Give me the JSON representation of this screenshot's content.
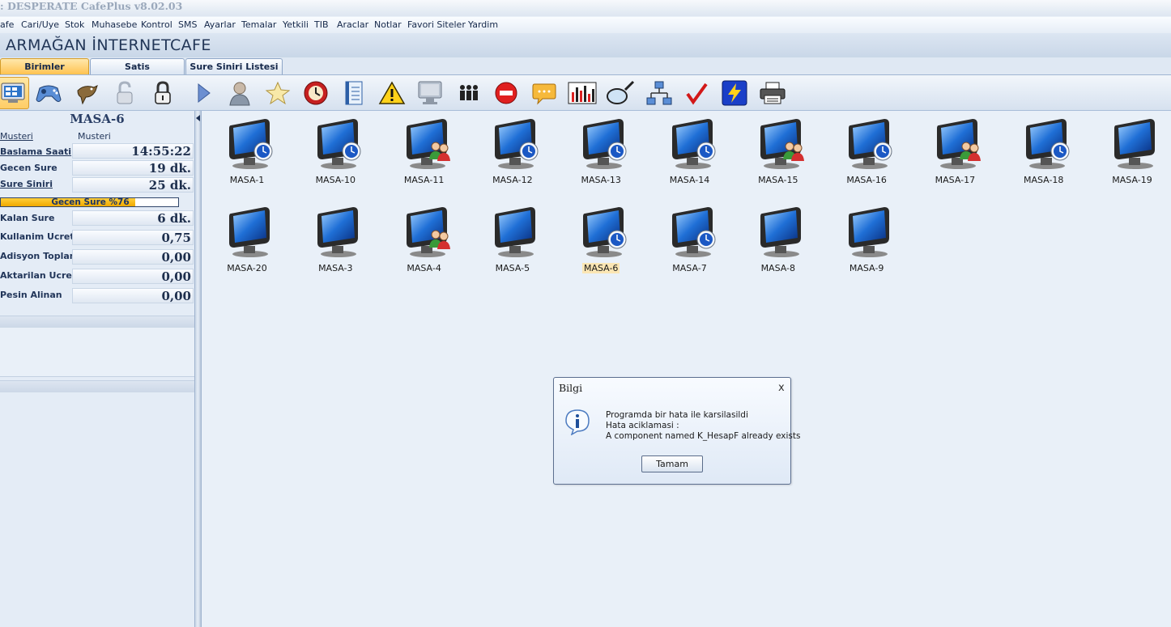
{
  "window": {
    "title": ": DESPERATE CafePlus v8.02.03"
  },
  "menu": [
    "afe",
    "Cari/Uye",
    "Stok",
    "Muhasebe",
    "Kontrol",
    "SMS",
    "Ayarlar",
    "Temalar",
    "Yetkili",
    "TIB",
    "Araclar",
    "Notlar",
    "Favori Siteler",
    "Yardim"
  ],
  "cafe_name": "ARMAĞAN İNTERNETCAFE",
  "tabs": [
    {
      "label": "Birimler",
      "active": true
    },
    {
      "label": "Satis",
      "active": false
    },
    {
      "label": "Sure Siniri Listesi",
      "active": false
    }
  ],
  "toolbar": {
    "icons": [
      "computer-grid-icon",
      "gamepad-icon",
      "bird-icon",
      "unlock-icon",
      "lock-icon",
      "play-icon",
      "user-icon",
      "star-icon",
      "clock-icon",
      "notebook-icon",
      "warning-icon",
      "monitor-icon",
      "people-icon",
      "stop-icon",
      "chat-icon",
      "chart-icon",
      "magnifier-icon",
      "network-icon",
      "check-icon",
      "lightning-icon",
      "printer-icon"
    ],
    "selected_index": 0
  },
  "selected_station": {
    "name": "MASA-6",
    "musteri_label": "Musteri",
    "musteri_value": "Musteri",
    "baslama_label": "Baslama Saati",
    "baslama_value": "14:55:22",
    "gecen_label": "Gecen Sure",
    "gecen_value": "19 dk.",
    "sinir_label": "Sure Siniri",
    "sinir_value": "25 dk.",
    "progress_label": "Gecen Sure %76",
    "progress_fraction": 0.76,
    "kalan_label": "Kalan Sure",
    "kalan_value": "6 dk.",
    "ucret_label": "Kullanim Ucreti",
    "ucret_value": "0,75",
    "adisyon_label": "Adisyon Toplami",
    "adisyon_value": "0,00",
    "aktarilan_label": "Aktarilan Ucret",
    "aktarilan_value": "0,00",
    "pesin_label": "Pesin Alinan",
    "pesin_value": "0,00"
  },
  "stations": [
    {
      "name": "MASA-1",
      "state": "timer"
    },
    {
      "name": "MASA-10",
      "state": "timer"
    },
    {
      "name": "MASA-11",
      "state": "member"
    },
    {
      "name": "MASA-12",
      "state": "timer"
    },
    {
      "name": "MASA-13",
      "state": "timer"
    },
    {
      "name": "MASA-14",
      "state": "timer"
    },
    {
      "name": "MASA-15",
      "state": "member"
    },
    {
      "name": "MASA-16",
      "state": "timer"
    },
    {
      "name": "MASA-17",
      "state": "member"
    },
    {
      "name": "MASA-18",
      "state": "timer"
    },
    {
      "name": "MASA-19",
      "state": "off"
    },
    {
      "name": "MASA-20",
      "state": "off"
    },
    {
      "name": "MASA-3",
      "state": "off"
    },
    {
      "name": "MASA-4",
      "state": "member"
    },
    {
      "name": "MASA-5",
      "state": "yellow"
    },
    {
      "name": "MASA-6",
      "state": "timer",
      "selected": true
    },
    {
      "name": "MASA-7",
      "state": "timer"
    },
    {
      "name": "MASA-8",
      "state": "off"
    },
    {
      "name": "MASA-9",
      "state": "off"
    }
  ],
  "dialog": {
    "title": "Bilgi",
    "close": "x",
    "line1": "Programda bir hata ile karsilasildi",
    "line2": "Hata aciklamasi :",
    "line3": "A component named K_HesapF already exists",
    "button": "Tamam"
  }
}
